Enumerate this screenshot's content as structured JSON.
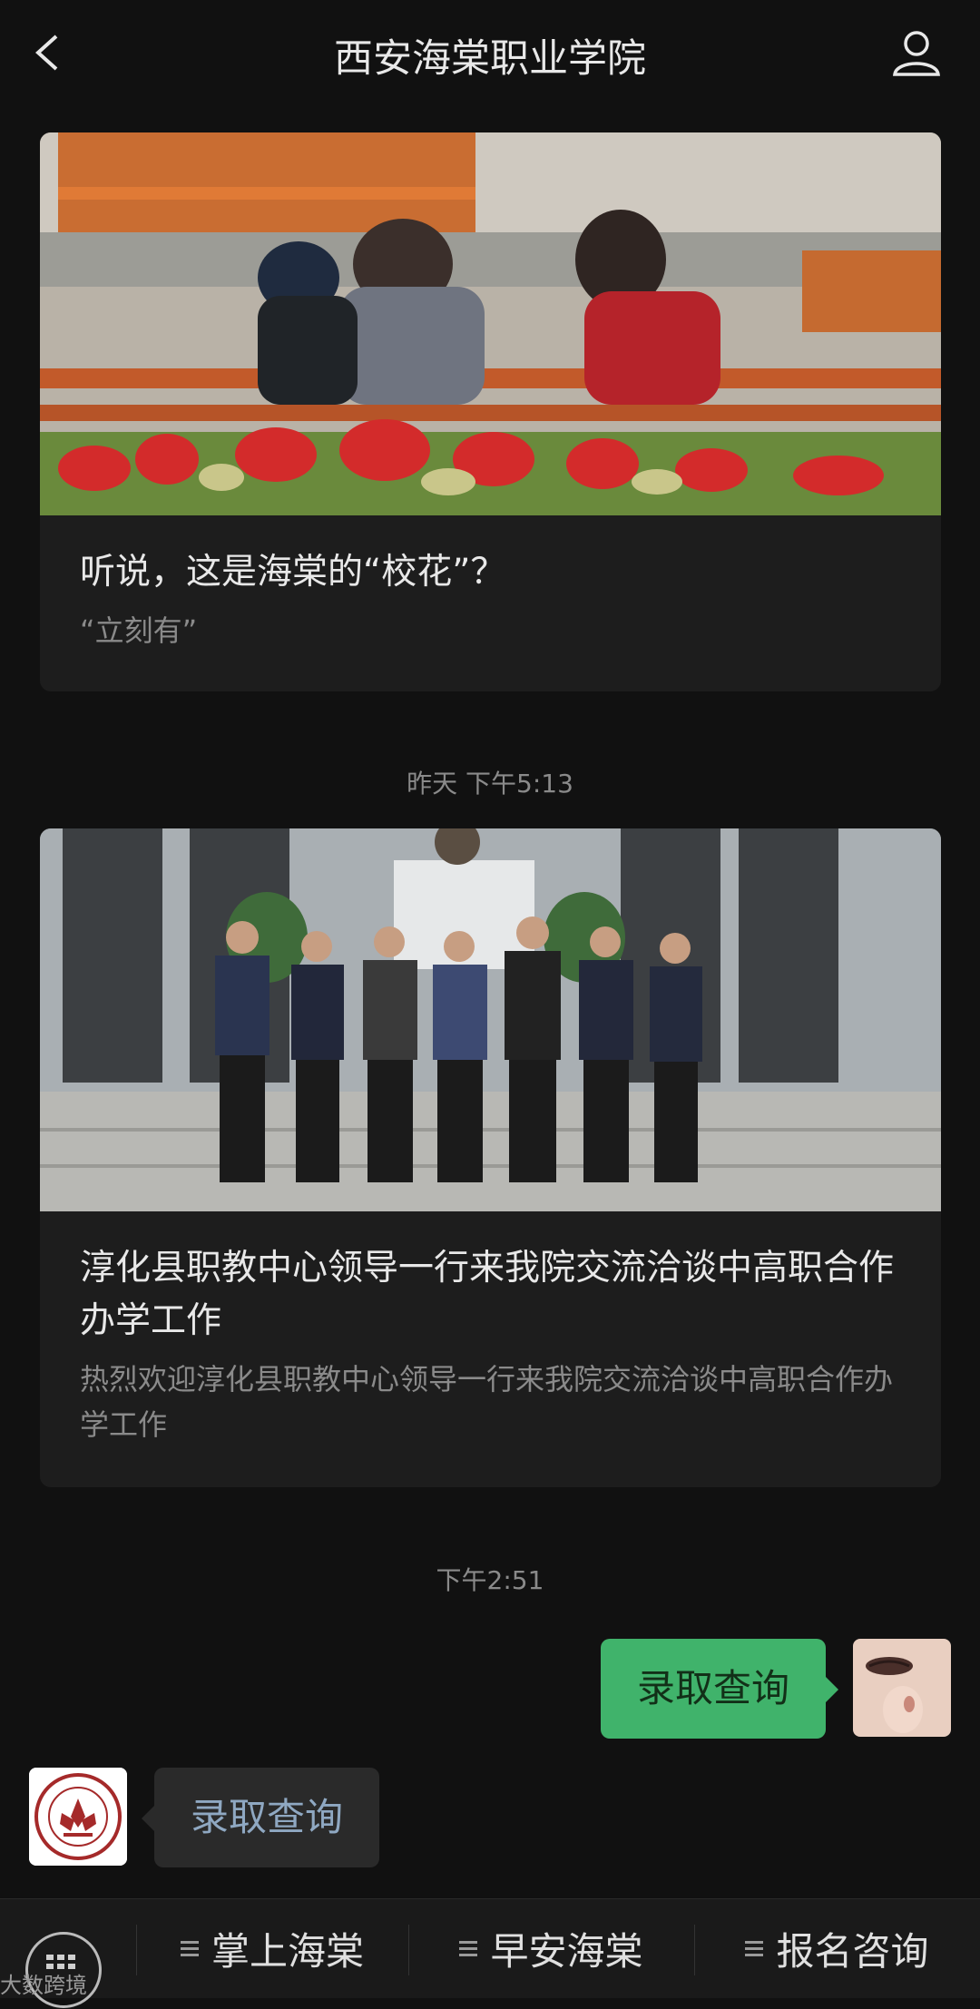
{
  "header": {
    "title": "西安海棠职业学院"
  },
  "articles": [
    {
      "title": "听说，这是海棠的“校花”？",
      "desc": "“立刻有”"
    },
    {
      "title": "淳化县职教中心领导一行来我院交流洽谈中高职合作办学工作",
      "desc": "热烈欢迎淳化县职教中心领导一行来我院交流洽谈中高职合作办学工作"
    }
  ],
  "timestamps": {
    "t1": "昨天 下午5:13",
    "t2": "下午2:51"
  },
  "chat": {
    "sent": "录取查询",
    "received": "录取查询"
  },
  "menu": {
    "item1": "掌上海棠",
    "item2": "早安海棠",
    "item3": "报名咨询"
  },
  "watermark": "大数跨境"
}
